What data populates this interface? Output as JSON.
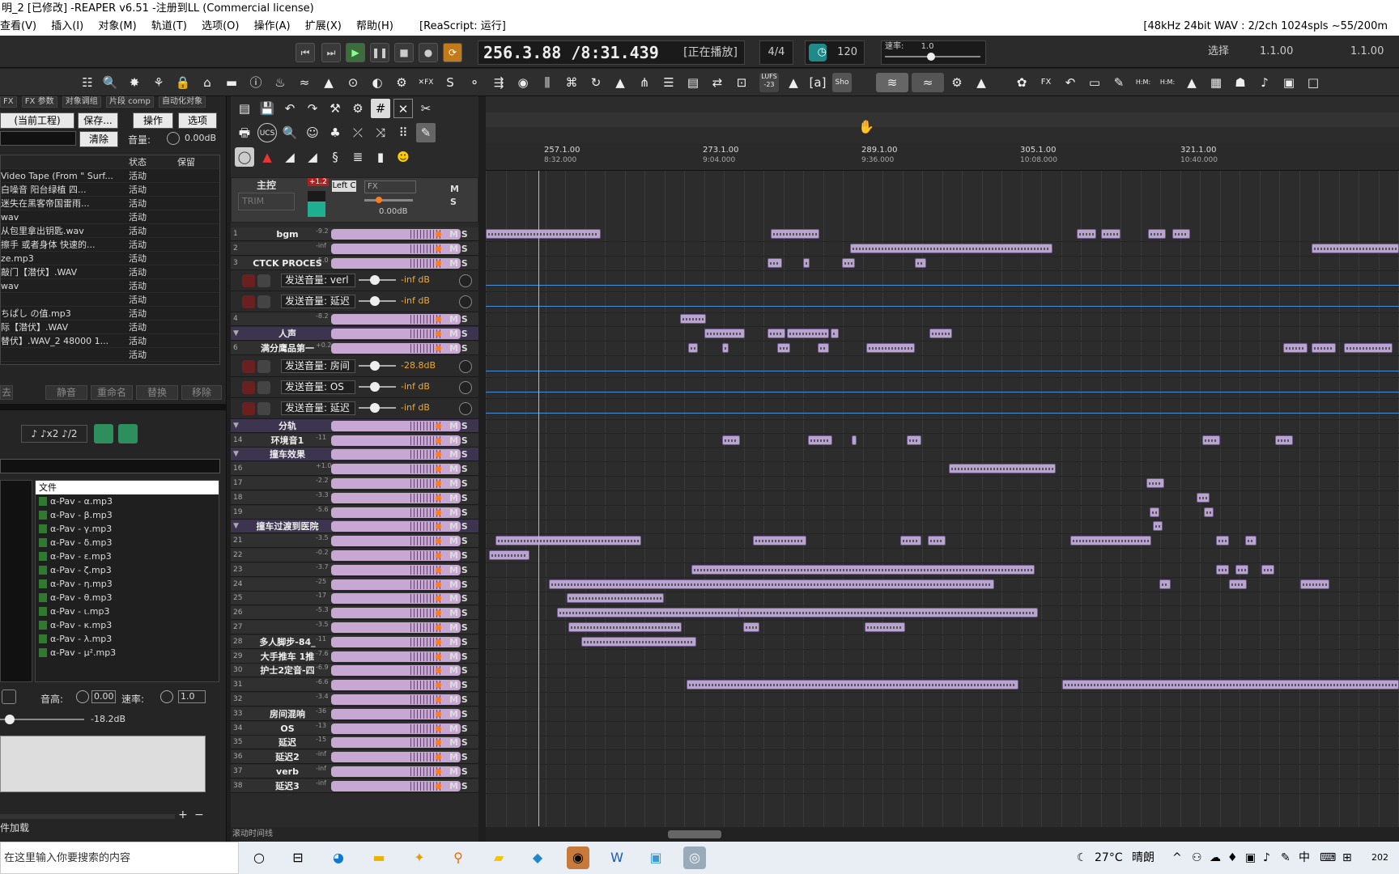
{
  "window": {
    "title": "明_2 [已修改] -REAPER v6.51 -注册到LL (Commercial license)"
  },
  "menu": {
    "items": [
      "查看(V)",
      "插入(I)",
      "对象(M)",
      "轨道(T)",
      "选项(O)",
      "操作(A)",
      "扩展(X)",
      "帮助(H)"
    ],
    "reascript": "[ReaScript: 运行]",
    "audio_info": "[48kHz 24bit WAV : 2/2ch 1024spls ~55/200m"
  },
  "transport": {
    "time": "256.3.88 /8:31.439",
    "status": "[正在播放]",
    "time_sig": "4/4",
    "tempo": "120",
    "rate_label": "速率:",
    "rate_value": "1.0",
    "select_label": "选择",
    "sel_start": "1.1.00",
    "sel_end": "1.1.00"
  },
  "toolbar": {
    "lufs": "LUFS -23",
    "fx": "FX",
    "s": "S"
  },
  "left": {
    "tabs": [
      "FX",
      "FX 参数",
      "对象调组",
      "片段 comp",
      "自动化对象"
    ],
    "project_dropdown": "(当前工程)",
    "save_btn": "保存...",
    "ops_btn": "操作",
    "opts_btn": "选项",
    "clear_btn": "清除",
    "vol_label": "音量:",
    "vol_value": "0.00dB",
    "col_status": "状态",
    "col_keep": "保留",
    "media_rows": [
      {
        "name": "Video Tape (From \" Surf...",
        "status": "活动"
      },
      {
        "name": "白噪音 阳台绿植 四...",
        "status": "活动"
      },
      {
        "name": "迷失在黑客帝国雷雨...",
        "status": "活动"
      },
      {
        "name": "wav",
        "status": "活动"
      },
      {
        "name": "从包里拿出钥匙.wav",
        "status": "活动"
      },
      {
        "name": "擦手 或者身体 快速的...",
        "status": "活动"
      },
      {
        "name": "ze.mp3",
        "status": "活动"
      },
      {
        "name": "敲门【潜伏】.WAV",
        "status": "活动"
      },
      {
        "name": "wav",
        "status": "活动"
      },
      {
        "name": "",
        "status": "活动"
      },
      {
        "name": "ちぱし の值.mp3",
        "status": "活动"
      },
      {
        "name": "际【潜伏】.WAV",
        "status": "活动"
      },
      {
        "name": "替伏】.WAV_2 48000 1...",
        "status": "活动"
      },
      {
        "name": "",
        "status": "活动"
      }
    ],
    "bottom_btns": [
      "静音",
      "重命名",
      "替换",
      "移除"
    ],
    "files_header": "文件",
    "files": [
      "α-Pav - α.mp3",
      "α-Pav - β.mp3",
      "α-Pav - γ.mp3",
      "α-Pav - δ.mp3",
      "α-Pav - ε.mp3",
      "α-Pav - ζ.mp3",
      "α-Pav - η.mp3",
      "α-Pav - θ.mp3",
      "α-Pav - ι.mp3",
      "α-Pav - κ.mp3",
      "α-Pav - λ.mp3",
      "α-Pav - μ².mp3"
    ],
    "pitch_label": "音高:",
    "pitch_value": "0.00",
    "rate_label": "速率:",
    "rate_value": "1.0",
    "preview_vol": "-18.2dB",
    "loading": "件加载"
  },
  "master": {
    "name": "主控",
    "trim": "TRIM",
    "peak": "+1.2",
    "routing": "Left C",
    "fx": "FX",
    "vol": "0.00dB"
  },
  "tracks": [
    {
      "n": "1",
      "name": "bgm",
      "pk": "-9.2"
    },
    {
      "n": "2",
      "name": "",
      "pk": "-inf"
    },
    {
      "n": "3",
      "name": "CTCK PROCES",
      "pk": "-5.0"
    },
    {
      "n": "4",
      "name": "",
      "pk": "-8.2"
    },
    {
      "n": "",
      "name": "人声",
      "pk": ""
    },
    {
      "n": "6",
      "name": "满分鹰品第一",
      "pk": "+0.2"
    },
    {
      "n": "",
      "name": "分轨",
      "pk": ""
    },
    {
      "n": "14",
      "name": "环境音1",
      "pk": "-11"
    },
    {
      "n": "",
      "name": "撞车效果",
      "pk": ""
    },
    {
      "n": "16",
      "name": "",
      "pk": "+1.0"
    },
    {
      "n": "17",
      "name": "",
      "pk": "-2.2"
    },
    {
      "n": "18",
      "name": "",
      "pk": "-3.3"
    },
    {
      "n": "19",
      "name": "",
      "pk": "-5.6"
    },
    {
      "n": "",
      "name": "撞车过渡到医院",
      "pk": ""
    },
    {
      "n": "21",
      "name": "",
      "pk": "-3.5"
    },
    {
      "n": "22",
      "name": "",
      "pk": "-0.2"
    },
    {
      "n": "23",
      "name": "",
      "pk": "-3.7"
    },
    {
      "n": "24",
      "name": "",
      "pk": "-25"
    },
    {
      "n": "25",
      "name": "",
      "pk": "-17"
    },
    {
      "n": "26",
      "name": "",
      "pk": "-5.3"
    },
    {
      "n": "27",
      "name": "",
      "pk": "-3.5"
    },
    {
      "n": "28",
      "name": "多人脚步-84_",
      "pk": "-11"
    },
    {
      "n": "29",
      "name": "大手推车 1推",
      "pk": "-7.6"
    },
    {
      "n": "30",
      "name": "护士2定音-四",
      "pk": "-6.9"
    },
    {
      "n": "31",
      "name": "",
      "pk": "-6.6"
    },
    {
      "n": "32",
      "name": "",
      "pk": "-3.4"
    },
    {
      "n": "33",
      "name": "房间混响",
      "pk": "-36"
    },
    {
      "n": "34",
      "name": "OS",
      "pk": "-13"
    },
    {
      "n": "35",
      "name": "延迟",
      "pk": "-15"
    },
    {
      "n": "36",
      "name": "延迟2",
      "pk": "-inf"
    },
    {
      "n": "37",
      "name": "verb",
      "pk": "-inf"
    },
    {
      "n": "38",
      "name": "延迟3",
      "pk": "-inf"
    }
  ],
  "sends": [
    {
      "label": "发送音量: verl",
      "db": "-inf dB"
    },
    {
      "label": "发送音量: 延迟",
      "db": "-inf dB"
    },
    {
      "label": "发送音量: 房间",
      "db": "-28.8dB"
    },
    {
      "label": "发送音量: OS",
      "db": "-inf dB"
    },
    {
      "label": "发送音量: 延迟",
      "db": "-inf dB"
    }
  ],
  "ms": "M S",
  "ruler": [
    {
      "bar": "257.1.00",
      "time": "8:32.000"
    },
    {
      "bar": "273.1.00",
      "time": "9:04.000"
    },
    {
      "bar": "289.1.00",
      "time": "9:36.000"
    },
    {
      "bar": "305.1.00",
      "time": "10:08.000"
    },
    {
      "bar": "321.1.00",
      "time": "10:40.000"
    }
  ],
  "scroll_label": "滚动时间线",
  "taskbar": {
    "search": "在这里输入你要搜索的内容",
    "weather": "27°C",
    "weather_desc": "晴朗",
    "ime": "中",
    "clock": "202"
  }
}
